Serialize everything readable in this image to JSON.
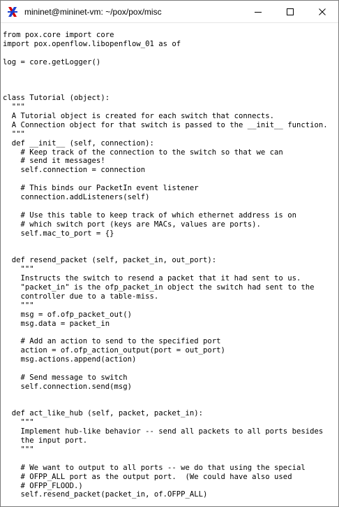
{
  "window": {
    "title": "mininet@mininet-vm: ~/pox/pox/misc",
    "app_icon": "xterm-x-icon",
    "controls": [
      "minimize-icon",
      "maximize-icon",
      "close-icon"
    ]
  },
  "terminal": {
    "lines": [
      "from pox.core import core",
      "import pox.openflow.libopenflow_01 as of",
      "",
      "log = core.getLogger()",
      "",
      "",
      "",
      "class Tutorial (object):",
      "  \"\"\"",
      "  A Tutorial object is created for each switch that connects.",
      "  A Connection object for that switch is passed to the __init__ function.",
      "  \"\"\"",
      "  def __init__ (self, connection):",
      "    # Keep track of the connection to the switch so that we can",
      "    # send it messages!",
      "    self.connection = connection",
      "",
      "    # This binds our PacketIn event listener",
      "    connection.addListeners(self)",
      "",
      "    # Use this table to keep track of which ethernet address is on",
      "    # which switch port (keys are MACs, values are ports).",
      "    self.mac_to_port = {}",
      "",
      "",
      "  def resend_packet (self, packet_in, out_port):",
      "    \"\"\"",
      "    Instructs the switch to resend a packet that it had sent to us.",
      "    \"packet_in\" is the ofp_packet_in object the switch had sent to the",
      "    controller due to a table-miss.",
      "    \"\"\"",
      "    msg = of.ofp_packet_out()",
      "    msg.data = packet_in",
      "",
      "    # Add an action to send to the specified port",
      "    action = of.ofp_action_output(port = out_port)",
      "    msg.actions.append(action)",
      "",
      "    # Send message to switch",
      "    self.connection.send(msg)",
      "",
      "",
      "  def act_like_hub (self, packet, packet_in):",
      "    \"\"\"",
      "    Implement hub-like behavior -- send all packets to all ports besides",
      "    the input port.",
      "    \"\"\"",
      "",
      "    # We want to output to all ports -- we do that using the special",
      "    # OFPP_ALL port as the output port.  (We could have also used",
      "    # OFPP_FLOOD.)",
      "    self.resend_packet(packet_in, of.OFPP_ALL)"
    ]
  }
}
